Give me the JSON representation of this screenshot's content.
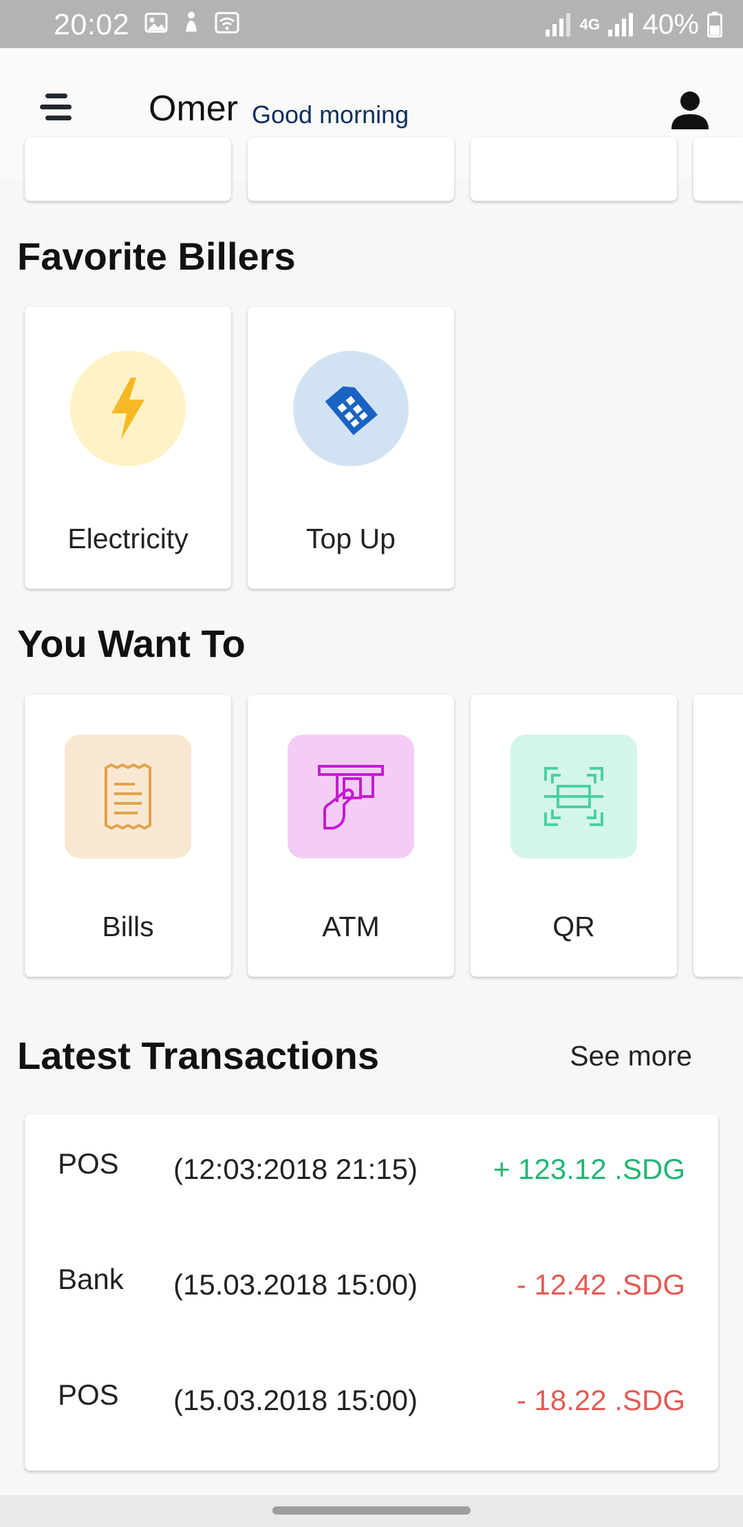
{
  "status_bar": {
    "time": "20:02",
    "network_label": "4G",
    "battery": "40%"
  },
  "header": {
    "name": "Omer",
    "greeting": "Good morning"
  },
  "favorite_billers": {
    "title": "Favorite Billers",
    "items": [
      {
        "label": "Electricity",
        "icon": "lightning-icon"
      },
      {
        "label": "Top Up",
        "icon": "sim-card-icon"
      }
    ]
  },
  "you_want_to": {
    "title": "You Want To",
    "items": [
      {
        "label": "Bills",
        "icon": "receipt-icon"
      },
      {
        "label": "ATM",
        "icon": "atm-icon"
      },
      {
        "label": "QR",
        "icon": "qr-scan-icon"
      }
    ]
  },
  "transactions": {
    "title": "Latest Transactions",
    "see_more": "See more",
    "rows": [
      {
        "type": "POS",
        "date": "(12:03:2018 21:15)",
        "amount": "+ 123.12 .SDG",
        "direction": "credit"
      },
      {
        "type": "Bank",
        "date": "(15.03.2018 15:00)",
        "amount": "- 12.42 .SDG",
        "direction": "debit"
      },
      {
        "type": "POS",
        "date": "(15.03.2018 15:00)",
        "amount": "- 18.22 .SDG",
        "direction": "debit"
      }
    ]
  },
  "colors": {
    "credit": "#22b573",
    "debit": "#e25b55",
    "greeting": "#0b2e5f",
    "electricity_bg": "#fff2c6",
    "topup_bg": "#d1e3f3",
    "bills_bg": "#f9e8d1",
    "atm_bg": "#f3cdf6",
    "qr_bg": "#d4f5ec"
  }
}
